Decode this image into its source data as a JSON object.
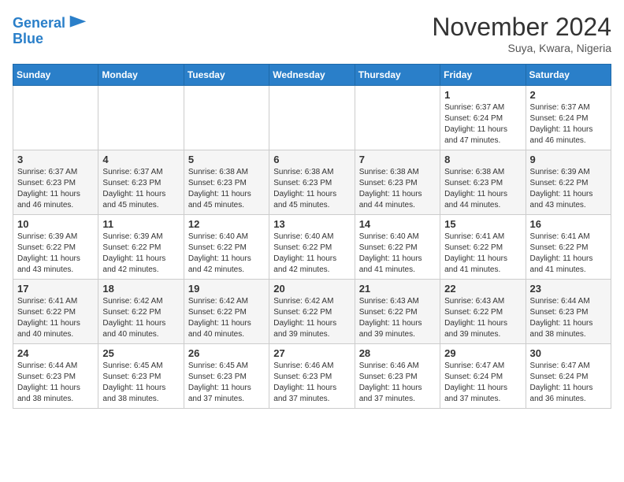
{
  "header": {
    "logo_line1": "General",
    "logo_line2": "Blue",
    "month_title": "November 2024",
    "subtitle": "Suya, Kwara, Nigeria"
  },
  "weekdays": [
    "Sunday",
    "Monday",
    "Tuesday",
    "Wednesday",
    "Thursday",
    "Friday",
    "Saturday"
  ],
  "weeks": [
    [
      {
        "day": "",
        "info": ""
      },
      {
        "day": "",
        "info": ""
      },
      {
        "day": "",
        "info": ""
      },
      {
        "day": "",
        "info": ""
      },
      {
        "day": "",
        "info": ""
      },
      {
        "day": "1",
        "info": "Sunrise: 6:37 AM\nSunset: 6:24 PM\nDaylight: 11 hours\nand 47 minutes."
      },
      {
        "day": "2",
        "info": "Sunrise: 6:37 AM\nSunset: 6:24 PM\nDaylight: 11 hours\nand 46 minutes."
      }
    ],
    [
      {
        "day": "3",
        "info": "Sunrise: 6:37 AM\nSunset: 6:23 PM\nDaylight: 11 hours\nand 46 minutes."
      },
      {
        "day": "4",
        "info": "Sunrise: 6:37 AM\nSunset: 6:23 PM\nDaylight: 11 hours\nand 45 minutes."
      },
      {
        "day": "5",
        "info": "Sunrise: 6:38 AM\nSunset: 6:23 PM\nDaylight: 11 hours\nand 45 minutes."
      },
      {
        "day": "6",
        "info": "Sunrise: 6:38 AM\nSunset: 6:23 PM\nDaylight: 11 hours\nand 45 minutes."
      },
      {
        "day": "7",
        "info": "Sunrise: 6:38 AM\nSunset: 6:23 PM\nDaylight: 11 hours\nand 44 minutes."
      },
      {
        "day": "8",
        "info": "Sunrise: 6:38 AM\nSunset: 6:23 PM\nDaylight: 11 hours\nand 44 minutes."
      },
      {
        "day": "9",
        "info": "Sunrise: 6:39 AM\nSunset: 6:22 PM\nDaylight: 11 hours\nand 43 minutes."
      }
    ],
    [
      {
        "day": "10",
        "info": "Sunrise: 6:39 AM\nSunset: 6:22 PM\nDaylight: 11 hours\nand 43 minutes."
      },
      {
        "day": "11",
        "info": "Sunrise: 6:39 AM\nSunset: 6:22 PM\nDaylight: 11 hours\nand 42 minutes."
      },
      {
        "day": "12",
        "info": "Sunrise: 6:40 AM\nSunset: 6:22 PM\nDaylight: 11 hours\nand 42 minutes."
      },
      {
        "day": "13",
        "info": "Sunrise: 6:40 AM\nSunset: 6:22 PM\nDaylight: 11 hours\nand 42 minutes."
      },
      {
        "day": "14",
        "info": "Sunrise: 6:40 AM\nSunset: 6:22 PM\nDaylight: 11 hours\nand 41 minutes."
      },
      {
        "day": "15",
        "info": "Sunrise: 6:41 AM\nSunset: 6:22 PM\nDaylight: 11 hours\nand 41 minutes."
      },
      {
        "day": "16",
        "info": "Sunrise: 6:41 AM\nSunset: 6:22 PM\nDaylight: 11 hours\nand 41 minutes."
      }
    ],
    [
      {
        "day": "17",
        "info": "Sunrise: 6:41 AM\nSunset: 6:22 PM\nDaylight: 11 hours\nand 40 minutes."
      },
      {
        "day": "18",
        "info": "Sunrise: 6:42 AM\nSunset: 6:22 PM\nDaylight: 11 hours\nand 40 minutes."
      },
      {
        "day": "19",
        "info": "Sunrise: 6:42 AM\nSunset: 6:22 PM\nDaylight: 11 hours\nand 40 minutes."
      },
      {
        "day": "20",
        "info": "Sunrise: 6:42 AM\nSunset: 6:22 PM\nDaylight: 11 hours\nand 39 minutes."
      },
      {
        "day": "21",
        "info": "Sunrise: 6:43 AM\nSunset: 6:22 PM\nDaylight: 11 hours\nand 39 minutes."
      },
      {
        "day": "22",
        "info": "Sunrise: 6:43 AM\nSunset: 6:22 PM\nDaylight: 11 hours\nand 39 minutes."
      },
      {
        "day": "23",
        "info": "Sunrise: 6:44 AM\nSunset: 6:23 PM\nDaylight: 11 hours\nand 38 minutes."
      }
    ],
    [
      {
        "day": "24",
        "info": "Sunrise: 6:44 AM\nSunset: 6:23 PM\nDaylight: 11 hours\nand 38 minutes."
      },
      {
        "day": "25",
        "info": "Sunrise: 6:45 AM\nSunset: 6:23 PM\nDaylight: 11 hours\nand 38 minutes."
      },
      {
        "day": "26",
        "info": "Sunrise: 6:45 AM\nSunset: 6:23 PM\nDaylight: 11 hours\nand 37 minutes."
      },
      {
        "day": "27",
        "info": "Sunrise: 6:46 AM\nSunset: 6:23 PM\nDaylight: 11 hours\nand 37 minutes."
      },
      {
        "day": "28",
        "info": "Sunrise: 6:46 AM\nSunset: 6:23 PM\nDaylight: 11 hours\nand 37 minutes."
      },
      {
        "day": "29",
        "info": "Sunrise: 6:47 AM\nSunset: 6:24 PM\nDaylight: 11 hours\nand 37 minutes."
      },
      {
        "day": "30",
        "info": "Sunrise: 6:47 AM\nSunset: 6:24 PM\nDaylight: 11 hours\nand 36 minutes."
      }
    ]
  ]
}
